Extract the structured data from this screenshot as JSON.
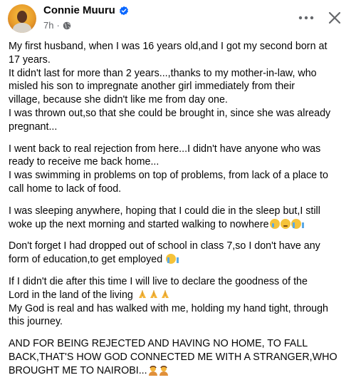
{
  "post": {
    "author_name": "Connie Muuru",
    "timestamp": "7h",
    "meta_separator": "·",
    "paragraphs": [
      {
        "lines": [
          "My first husband, when I was 16 years old,and I got my second born at",
          "17 years.",
          "It didn't last for more than 2 years...,thanks to my mother-in-law, who",
          "misled his son to impregnate another girl immediately from their",
          "village, because she didn't like me from day one.",
          "I was thrown out,so that she could be brought in, since she was already",
          "pregnant..."
        ]
      },
      {
        "lines": [
          "I went back to real rejection from here...I didn't have anyone who was",
          "ready to receive me back home...",
          "I was swimming in problems on top of problems, from lack of a place to",
          "call home to lack of food."
        ]
      },
      {
        "lines": [
          "I was sleeping anywhere, hoping that I could die in the sleep but,I still",
          "woke up the next morning and started walking to nowhere"
        ]
      },
      {
        "lines": [
          "Don't forget I had dropped out of school in class 7,so I don't have any",
          "form of education,to get employed"
        ]
      },
      {
        "lines": [
          "If I didn't die after this time I will live to declare the goodness of the",
          "Lord in the land of the living",
          "My God is real and has walked with me, holding my hand tight, through",
          "this journey."
        ]
      },
      {
        "lines": [
          "AND FOR BEING REJECTED AND HAVING NO HOME, TO FALL",
          "BACK,THAT'S HOW GOD CONNECTED ME WITH A STRANGER,WHO",
          "BROUGHT ME TO NAIROBI..."
        ]
      }
    ]
  },
  "icons": {
    "verified": "verified-badge-icon",
    "audience": "globe-icon",
    "more": "more-options-icon",
    "close": "close-icon"
  },
  "colors": {
    "verified_blue": "#0866ff",
    "meta_gray": "#65676b",
    "text": "#050505"
  }
}
